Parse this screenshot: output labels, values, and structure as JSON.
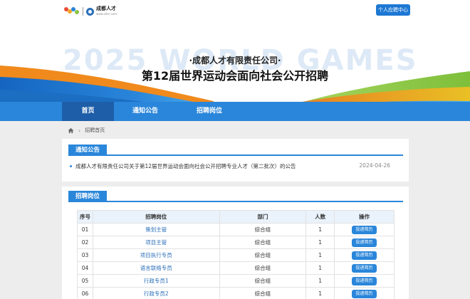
{
  "header": {
    "logo_text": "成都人才",
    "logo_sub": "www.cdrc.com",
    "user_center_label": "个人应聘中心"
  },
  "banner": {
    "watermark": "2025 WORLD GAMES",
    "company": "·成都人才有限责任公司·",
    "headline": "第12届世界运动会面向社会公开招聘"
  },
  "nav": {
    "items": [
      {
        "label": "首页"
      },
      {
        "label": "通知公告"
      },
      {
        "label": "招聘岗位"
      }
    ]
  },
  "breadcrumb": {
    "current": "招聘首页"
  },
  "notices": {
    "title": "通知公告",
    "items": [
      {
        "text": "成都人才有限责任公司关于第12届世界运动会面向社会公开招聘专业人才（第二批次）的公告",
        "date": "2024-04-26"
      }
    ]
  },
  "jobs": {
    "title": "招聘岗位",
    "headers": [
      "序号",
      "招聘岗位",
      "部门",
      "人数",
      "操作"
    ],
    "rows": [
      {
        "no": "01",
        "job": "策划主管",
        "dept": "综合组",
        "count": "1",
        "action": "投递简历"
      },
      {
        "no": "02",
        "job": "项目主管",
        "dept": "综合组",
        "count": "1",
        "action": "投递简历"
      },
      {
        "no": "03",
        "job": "项目执行专员",
        "dept": "综合组",
        "count": "1",
        "action": "投递简历"
      },
      {
        "no": "04",
        "job": "语言联络专员",
        "dept": "综合组",
        "count": "1",
        "action": "投递简历"
      },
      {
        "no": "05",
        "job": "行政专员1",
        "dept": "综合组",
        "count": "1",
        "action": "投递简历"
      },
      {
        "no": "06",
        "job": "行政专员2",
        "dept": "综合组",
        "count": "1",
        "action": "投递简历"
      }
    ]
  },
  "colors": {
    "primary": "#2a86da",
    "nav_active": "#1e5ea8",
    "accent_orange": "#f08a1c",
    "accent_green": "#8cc43f"
  }
}
